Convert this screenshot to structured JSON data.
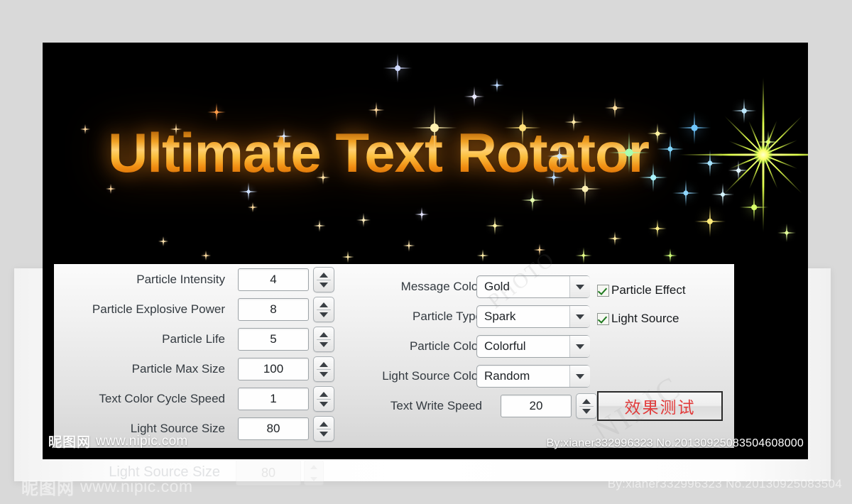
{
  "app": {
    "title": "Ultimate Text Rotator"
  },
  "theme": {
    "page_background": "#d9d9d9",
    "stage_background": "#000000",
    "panel_background": "#eeeeee",
    "title_gradient_top": "#b15f06",
    "title_gradient_mid": "#ffd070",
    "title_gradient_bottom": "#8d4403",
    "check_color": "#1f7a1f",
    "test_button_text_color": "#e23b3b"
  },
  "form": {
    "left_column": [
      {
        "label": "Particle Intensity",
        "value": "4",
        "control": "spinner"
      },
      {
        "label": "Particle Explosive Power",
        "value": "8",
        "control": "spinner"
      },
      {
        "label": "Particle Life",
        "value": "5",
        "control": "spinner"
      },
      {
        "label": "Particle Max Size",
        "value": "100",
        "control": "spinner"
      },
      {
        "label": "Text Color Cycle Speed",
        "value": "1",
        "control": "spinner"
      },
      {
        "label": "Light Source Size",
        "value": "80",
        "control": "spinner"
      }
    ],
    "middle_column": [
      {
        "label": "Message Color",
        "value": "Gold",
        "control": "dropdown"
      },
      {
        "label": "Particle Type",
        "value": "Spark",
        "control": "dropdown"
      },
      {
        "label": "Particle Color",
        "value": "Colorful",
        "control": "dropdown"
      },
      {
        "label": "Light Source Color",
        "value": "Random",
        "control": "dropdown"
      },
      {
        "label": "Text Write Speed",
        "value": "20",
        "control": "spinner"
      }
    ],
    "right_column": {
      "checkboxes": [
        {
          "label": "Particle Effect",
          "checked": true
        },
        {
          "label": "Light Source",
          "checked": true
        }
      ],
      "test_button_label": "效果测试"
    }
  },
  "watermarks": {
    "logo_cjk": "昵图网",
    "logo_url": "www.nipic.com",
    "credit": "By:xianer332996323  No.20130925083504608000",
    "photo_overlay": "PHOTO",
    "photo_overlay2": "NIPIC"
  },
  "ghost": {
    "label": "Light Source Size",
    "value": "80",
    "logo_cjk": "昵图网",
    "logo_url": "www.nipic.com",
    "credit": "By:xianer332996323  No.20130925083504"
  }
}
